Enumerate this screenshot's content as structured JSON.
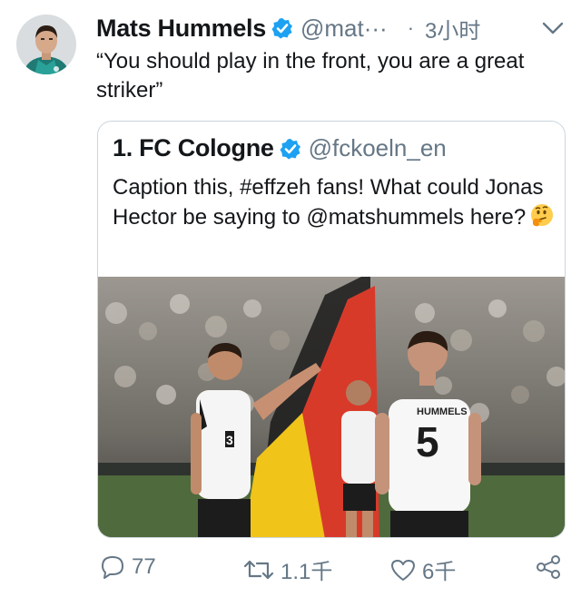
{
  "author": {
    "name": "Mats Hummels",
    "handle": "@mat···",
    "separator": "·",
    "time": "3小时"
  },
  "tweet": {
    "text": "“You should play in the front, you are a great striker”"
  },
  "quoted": {
    "name": "1. FC Cologne",
    "handle": "@fckoeln_en",
    "text": "Caption this, #effzeh fans! What could Jonas Hector be saying to @matshummels here?",
    "emoji": "thinking-face",
    "photo": {
      "jersey_name": "HUMMELS",
      "jersey_number": "5",
      "other_number": "3"
    }
  },
  "actions": {
    "replies": "77",
    "retweets": "1.1千",
    "likes": "6千"
  },
  "colors": {
    "verified": "#1da1f2",
    "muted_text": "#657786",
    "border": "#ccd6dd"
  }
}
